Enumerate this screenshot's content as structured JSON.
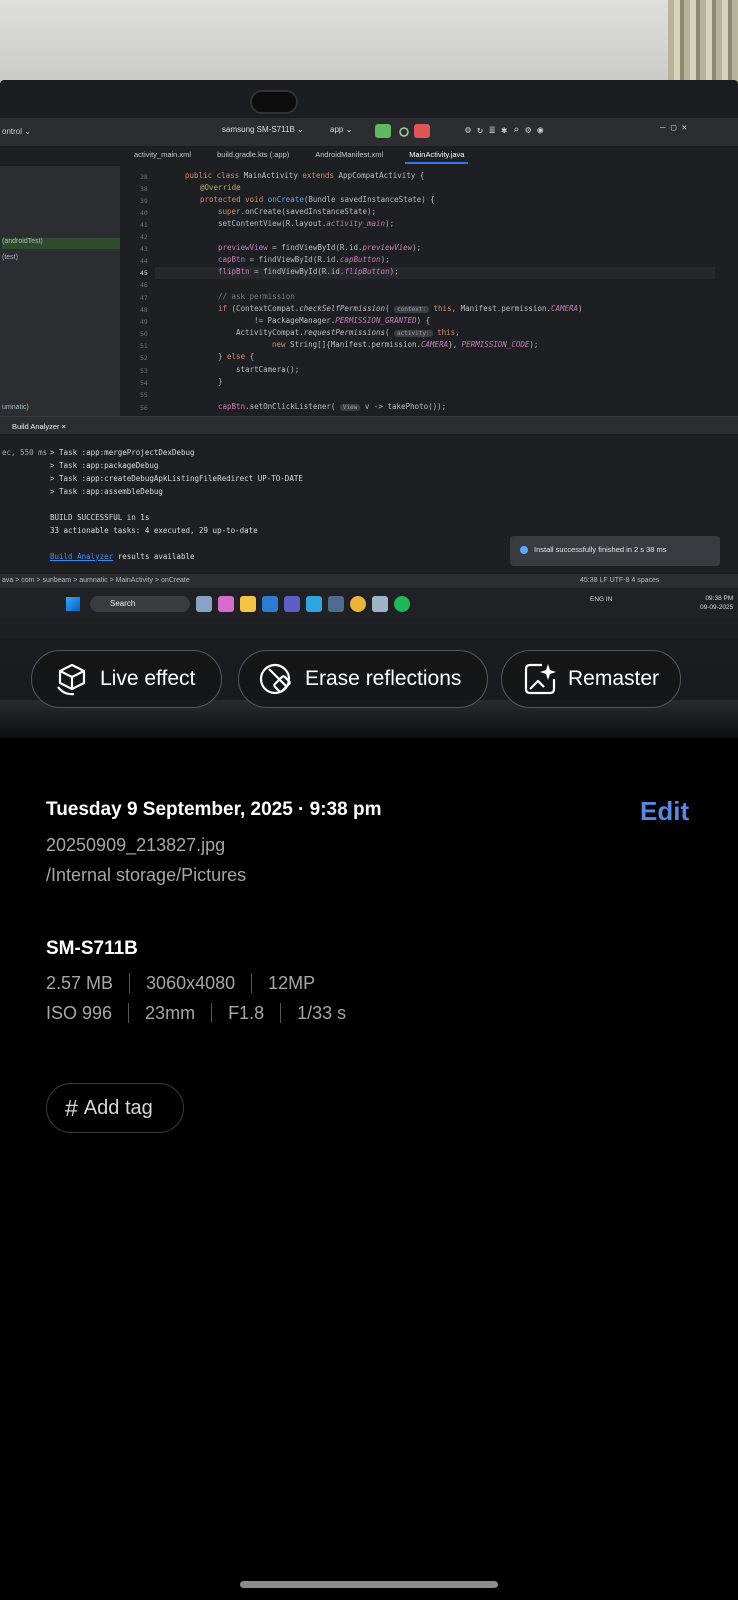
{
  "photo": {
    "ide": {
      "project_menu": "ontrol ⌄",
      "device": "samsung SM-S711B ⌄",
      "run_config": "app ⌄",
      "tabs": [
        "activity_main.xml",
        "build.gradle.kts (:app)",
        "AndroidManifest.xml",
        "MainActivity.java"
      ],
      "left_items": [
        "(androidTest)",
        "(test)",
        "umnatic)"
      ],
      "build_tab": "Build Analyzer ×",
      "build_time": "ec, 550 ms",
      "build_lines": [
        "> Task :app:mergeProjectDexDebug",
        "> Task :app:packageDebug",
        "> Task :app:createDebugApkListingFileRedirect UP-TO-DATE",
        "> Task :app:assembleDebug",
        "BUILD SUCCESSFUL in 1s",
        "33 actionable tasks: 4 executed, 29 up-to-date"
      ],
      "build_link": "Build Analyzer",
      "build_link_suffix": " results available",
      "toast": "Install successfully finished in 2 s 38 ms",
      "breadcrumb": "ava > com > sunbeam > aumnatic > MainActivity > onCreate",
      "cursor_pos": "45:38   LF   UTF-8        4 spaces",
      "taskbar_search": "Search",
      "tray_lang": "ENG IN",
      "clock_time": "09:38 PM",
      "clock_date": "09-09-2025"
    }
  },
  "actions": {
    "live_effect": "Live effect",
    "erase_reflections": "Erase reflections",
    "remaster": "Remaster"
  },
  "details": {
    "datetime": "Tuesday 9 September, 2025 · 9:38 pm",
    "edit": "Edit",
    "filename": "20250909_213827.jpg",
    "path": "/Internal storage/Pictures",
    "model": "SM-S711B",
    "row1": [
      "2.57 MB",
      "3060x4080",
      "12MP"
    ],
    "row2": [
      "ISO 996",
      "23mm",
      "F1.8",
      "1/33 s"
    ],
    "add_tag": "Add tag"
  },
  "colors": {
    "accent": "#5b86e5",
    "background": "#000000",
    "secondary_text": "#a6a6a6"
  }
}
